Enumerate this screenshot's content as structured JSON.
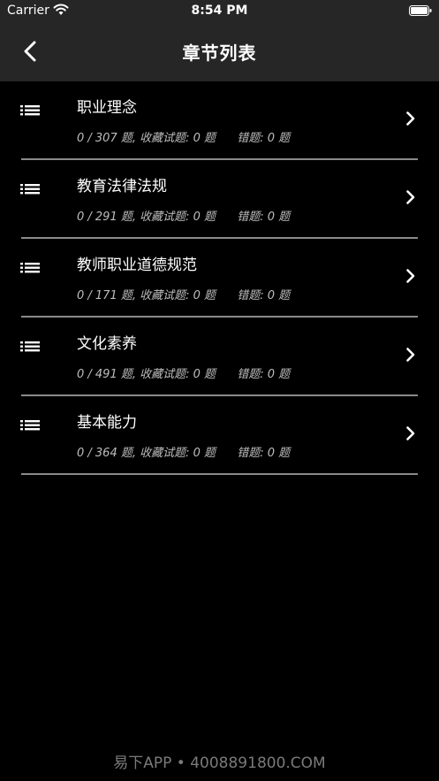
{
  "status_bar": {
    "carrier": "Carrier",
    "time": "8:54 PM"
  },
  "nav": {
    "title": "章节列表"
  },
  "chapters": [
    {
      "title": "职业理念",
      "progress": "0 / 307 题,",
      "favorites": "收藏试题: 0 题",
      "errors": "错题: 0 题"
    },
    {
      "title": "教育法律法规",
      "progress": "0 / 291 题,",
      "favorites": "收藏试题: 0 题",
      "errors": "错题: 0 题"
    },
    {
      "title": "教师职业道德规范",
      "progress": "0 / 171 题,",
      "favorites": "收藏试题: 0 题",
      "errors": "错题: 0 题"
    },
    {
      "title": "文化素养",
      "progress": "0 / 491 题,",
      "favorites": "收藏试题: 0 题",
      "errors": "错题: 0 题"
    },
    {
      "title": "基本能力",
      "progress": "0 / 364 题,",
      "favorites": "收藏试题: 0 题",
      "errors": "错题: 0 题"
    }
  ],
  "watermark": "易下APP • 4008891800.COM",
  "colors": {
    "background": "#000000",
    "bar": "#262626",
    "divider": "#8a8a8a",
    "subtext": "#bdbdbd"
  },
  "icons": {
    "back": "chevron-left-icon",
    "row": "list-icon",
    "row_action": "chevron-right-icon"
  }
}
